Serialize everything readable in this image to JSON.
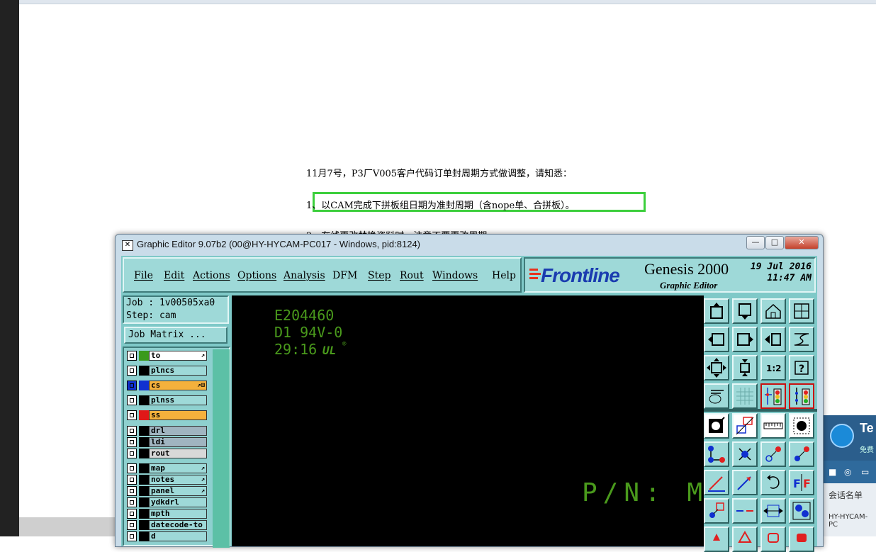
{
  "document": {
    "line1": "11月7号，P3厂V005客户代码订单封周期方式做调整，请知悉：",
    "line2": "1、以CAM完成下拼板组日期为准封周期（含nope单、合拼板）。",
    "line3_partial": "2、在线更改替换资料时，注意不要更改周期"
  },
  "window": {
    "title": "Graphic Editor 9.07b2 (00@HY-HYCAM-PC017 - Windows, pid:8124)",
    "minimize_glyph": "—",
    "maximize_glyph": "□",
    "close_glyph": "✕"
  },
  "menu": {
    "file": "File",
    "edit": "Edit",
    "actions": "Actions",
    "options": "Options",
    "analysis": "Analysis",
    "dfm": "DFM",
    "step": "Step",
    "rout": "Rout",
    "windows": "Windows",
    "help": "Help"
  },
  "brand": {
    "logo": "Frontline",
    "product": "Genesis 2000",
    "subtitle": "Graphic Editor",
    "date": "19 Jul 2016",
    "time": "11:47 AM"
  },
  "job": {
    "job_line": "Job : 1v00505xa0",
    "step_line": "Step: cam",
    "matrix_button": "Job Matrix ..."
  },
  "layers": [
    {
      "name": "to",
      "color": "#3a9a1c",
      "bg": "#ffffff",
      "mark": "↗"
    },
    {
      "name": "plncs",
      "color": "#000000",
      "bg": "#9ed9d8",
      "mark": ""
    },
    {
      "name": "cs",
      "color": "#1030d0",
      "bg": "#f4b13c",
      "mark": "↗⊞",
      "selected": true
    },
    {
      "name": "plnss",
      "color": "#000000",
      "bg": "#9ed9d8",
      "mark": ""
    },
    {
      "name": "ss",
      "color": "#e01818",
      "bg": "#f4b13c",
      "mark": ""
    },
    {
      "name": "drl",
      "color": "#000000",
      "bg": "#a0b4c0",
      "mark": ""
    },
    {
      "name": "ldi",
      "color": "#000000",
      "bg": "#a0b4c0",
      "mark": ""
    },
    {
      "name": "rout",
      "color": "#000000",
      "bg": "#d8d8d8",
      "mark": ""
    },
    {
      "name": "map",
      "color": "#000000",
      "bg": "#9ed9d8",
      "mark": "↗"
    },
    {
      "name": "notes",
      "color": "#000000",
      "bg": "#9ed9d8",
      "mark": "↗"
    },
    {
      "name": "panel",
      "color": "#000000",
      "bg": "#9ed9d8",
      "mark": "↗"
    },
    {
      "name": "ydkdrl",
      "color": "#000000",
      "bg": "#9ed9d8",
      "mark": ""
    },
    {
      "name": "mpth",
      "color": "#000000",
      "bg": "#9ed9d8",
      "mark": ""
    },
    {
      "name": "datecode-to",
      "color": "#000000",
      "bg": "#9ed9d8",
      "mark": ""
    },
    {
      "name": "d",
      "color": "#000000",
      "bg": "#9ed9d8",
      "mark": ""
    }
  ],
  "canvas": {
    "line1": "E204460",
    "line2": "D1 94V-0",
    "line3": "29:16",
    "ul_mark": "UL",
    "reg_mark": "®",
    "pn": "P/N: MT"
  },
  "teamviewer": {
    "title": "Te",
    "subtitle": "免费",
    "label": "会话名单",
    "host": "HY-HYCAM-PC"
  },
  "colors": {
    "panel_bg": "#9ed9d8",
    "canvas_bg": "#000000",
    "canvas_text": "#4a9a1c",
    "highlight": "#3ccf3c",
    "brand_blue": "#1a3cb0"
  }
}
